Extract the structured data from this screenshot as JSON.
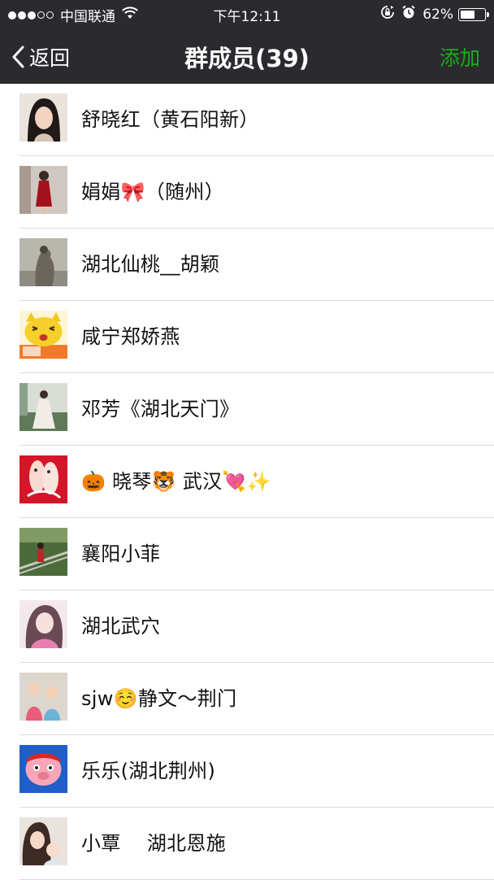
{
  "status_bar": {
    "carrier": "中国联通",
    "time": "下午12:11",
    "battery_percent": "62%",
    "battery_level": 0.62,
    "icons": [
      "signal-dots-icon",
      "wifi-icon",
      "rotation-lock-icon",
      "alarm-icon",
      "battery-icon"
    ]
  },
  "navbar": {
    "back_label": "返回",
    "title": "群成员(39)",
    "action_label": "添加",
    "accent_color": "#1aad19",
    "background_color": "#2b2a2f"
  },
  "members": [
    {
      "name": "舒晓红（黄石阳新）",
      "avatar": "photo-avatar"
    },
    {
      "name": "娟娟🎀（随州）",
      "avatar": "photo-avatar"
    },
    {
      "name": "湖北仙桃__胡颖",
      "avatar": "photo-avatar"
    },
    {
      "name": "咸宁郑娇燕",
      "avatar": "cartoon-cat-avatar"
    },
    {
      "name": "邓芳《湖北天门》",
      "avatar": "photo-avatar"
    },
    {
      "name": "🎃 晓琴🐯 武汉💘✨",
      "avatar": "illustration-avatar"
    },
    {
      "name": "襄阳小菲",
      "avatar": "photo-avatar"
    },
    {
      "name": "湖北武穴",
      "avatar": "photo-avatar"
    },
    {
      "name": "sjw☺️静文～荆门",
      "avatar": "photo-avatar"
    },
    {
      "name": "乐乐(湖北荆州)",
      "avatar": "cartoon-pig-avatar"
    },
    {
      "name": "小覃　 湖北恩施",
      "avatar": "photo-avatar"
    }
  ]
}
